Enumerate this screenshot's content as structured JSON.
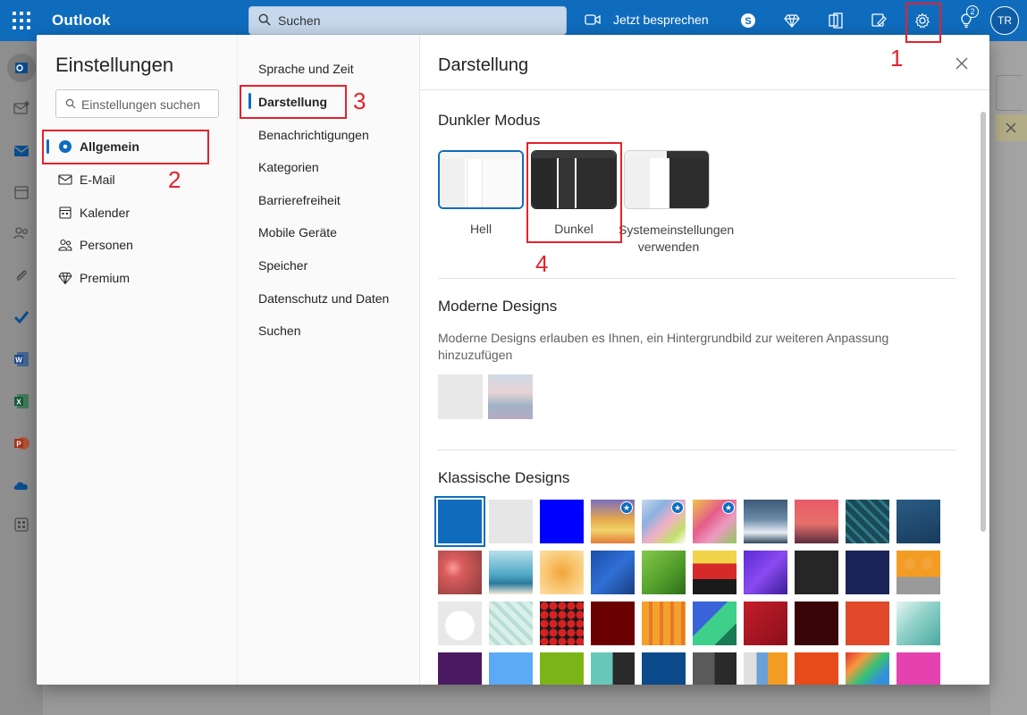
{
  "app": {
    "brand": "Outlook",
    "search_placeholder": "Suchen",
    "meet_label": "Jetzt besprechen",
    "notification_count": "2",
    "avatar_initials": "TR",
    "accent": "#0f6cbd"
  },
  "settings": {
    "title": "Einstellungen",
    "search_placeholder": "Einstellungen suchen",
    "categories": [
      {
        "label": "Allgemein",
        "icon": "gear-icon",
        "active": true
      },
      {
        "label": "E-Mail",
        "icon": "mail-icon"
      },
      {
        "label": "Kalender",
        "icon": "calendar-icon"
      },
      {
        "label": "Personen",
        "icon": "people-icon"
      },
      {
        "label": "Premium",
        "icon": "diamond-icon"
      }
    ],
    "subcategories": [
      {
        "label": "Sprache und Zeit"
      },
      {
        "label": "Darstellung",
        "active": true
      },
      {
        "label": "Benachrichtigungen"
      },
      {
        "label": "Kategorien"
      },
      {
        "label": "Barrierefreiheit"
      },
      {
        "label": "Mobile Geräte"
      },
      {
        "label": "Speicher"
      },
      {
        "label": "Datenschutz und Daten"
      },
      {
        "label": "Suchen"
      }
    ]
  },
  "pane": {
    "title": "Darstellung",
    "dark_mode": {
      "title": "Dunkler Modus",
      "options": [
        {
          "label": "Hell",
          "selected": true
        },
        {
          "label": "Dunkel"
        },
        {
          "label": "Systemeinstellungen verwenden"
        }
      ]
    },
    "modern": {
      "title": "Moderne Designs",
      "description": "Moderne Designs erlauben es Ihnen, ein Hintergrundbild zur weiteren Anpassung hinzuzufügen"
    },
    "classic": {
      "title": "Klassische Designs"
    }
  },
  "annotations": [
    "1",
    "2",
    "3",
    "4"
  ]
}
